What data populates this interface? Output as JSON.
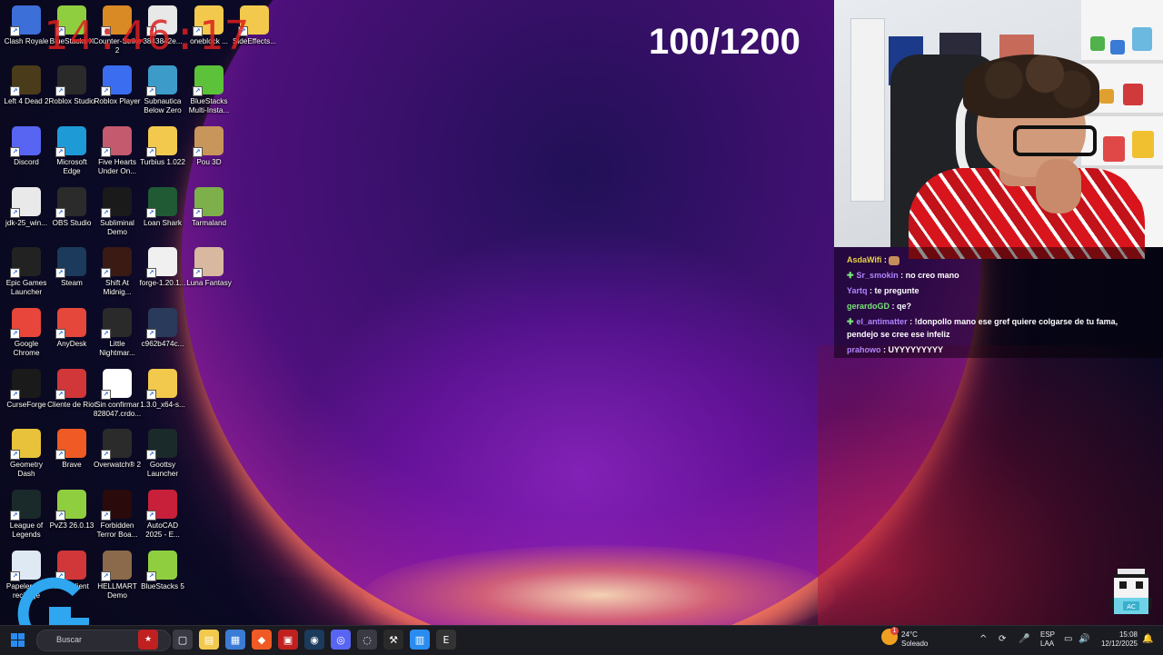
{
  "overlay": {
    "clock": "14:46:17",
    "counter": "100/1200"
  },
  "desktop": {
    "icons": [
      {
        "label": "Clash Royale",
        "icon": "clash-royale-icon",
        "color": "#3d6fd8"
      },
      {
        "label": "BlueStacks X",
        "icon": "bluestacks-icon",
        "color": "#8fcf3f"
      },
      {
        "label": "Counter-Strike 2",
        "icon": "counter-strike-icon",
        "color": "#d98a24"
      },
      {
        "label": "3843842e...",
        "icon": "image-file-icon",
        "color": "#e8e8e8"
      },
      {
        "label": "oneblock ...",
        "icon": "folder-icon",
        "color": "#f2c94c"
      },
      {
        "label": "SideEffects...",
        "icon": "folder-icon",
        "color": "#f2c94c"
      },
      {
        "label": "Left 4 Dead 2",
        "icon": "left4dead-icon",
        "color": "#4a3b1a"
      },
      {
        "label": "Roblox Studio",
        "icon": "roblox-studio-icon",
        "color": "#2a2a2a"
      },
      {
        "label": "Roblox Player",
        "icon": "roblox-player-icon",
        "color": "#3a6df0"
      },
      {
        "label": "Subnautica Below Zero",
        "icon": "subnautica-icon",
        "color": "#3d9bc9"
      },
      {
        "label": "BlueStacks Multi-Insta...",
        "icon": "bluestacks-multi-icon",
        "color": "#5cc23a"
      },
      {
        "label": "Discord",
        "icon": "discord-icon",
        "color": "#5865f2"
      },
      {
        "label": "Microsoft Edge",
        "icon": "edge-icon",
        "color": "#1e9bd7"
      },
      {
        "label": "Five Hearts Under On...",
        "icon": "five-hearts-icon",
        "color": "#c45a6e"
      },
      {
        "label": "Turbius 1.022",
        "icon": "folder-icon",
        "color": "#f2c94c"
      },
      {
        "label": "Pou 3D",
        "icon": "pou-icon",
        "color": "#c8955a"
      },
      {
        "label": "jdk-25_win...",
        "icon": "java-installer-icon",
        "color": "#e9e9e9"
      },
      {
        "label": "OBS Studio",
        "icon": "obs-icon",
        "color": "#2b2b2b"
      },
      {
        "label": "Subliminal Demo",
        "icon": "subliminal-icon",
        "color": "#1a1a1a"
      },
      {
        "label": "Loan Shark",
        "icon": "loan-shark-icon",
        "color": "#1f5a34"
      },
      {
        "label": "Tarmaland",
        "icon": "tarmaland-icon",
        "color": "#7db04a"
      },
      {
        "label": "Epic Games Launcher",
        "icon": "epic-games-icon",
        "color": "#222222"
      },
      {
        "label": "Steam",
        "icon": "steam-icon",
        "color": "#1b3a5c"
      },
      {
        "label": "Shift At Midnig...",
        "icon": "shift-at-midnight-icon",
        "color": "#3a1a12"
      },
      {
        "label": "forge-1.20.1...",
        "icon": "java-file-icon",
        "color": "#f0f0f0"
      },
      {
        "label": "Luna Fantasy",
        "icon": "luna-fantasy-icon",
        "color": "#d9b8a0"
      },
      {
        "label": "Google Chrome",
        "icon": "chrome-icon",
        "color": "#e8463a"
      },
      {
        "label": "AnyDesk",
        "icon": "anydesk-icon",
        "color": "#e5473b"
      },
      {
        "label": "Little Nightmar...",
        "icon": "little-nightmares-icon",
        "color": "#2a2a2a"
      },
      {
        "label": "c962b474c...",
        "icon": "image-file-icon",
        "color": "#2a3a5a"
      },
      {
        "label": "CurseForge",
        "icon": "curseforge-icon",
        "color": "#1a1a1a"
      },
      {
        "label": "Cliente de Riot",
        "icon": "riot-client-icon",
        "color": "#d13639"
      },
      {
        "label": "Sin confirmar 828047.crdo...",
        "icon": "blank-file-icon",
        "color": "#ffffff"
      },
      {
        "label": "1.3.0_x64-s...",
        "icon": "folder-icon",
        "color": "#f2c94c"
      },
      {
        "label": "Geometry Dash",
        "icon": "geometry-dash-icon",
        "color": "#e8c23a"
      },
      {
        "label": "Brave",
        "icon": "brave-icon",
        "color": "#f05a24"
      },
      {
        "label": "Overwatch® 2",
        "icon": "overwatch-icon",
        "color": "#2b2b2b"
      },
      {
        "label": "Goottsy Launcher",
        "icon": "goottsy-icon",
        "color": "#1a2a2a"
      },
      {
        "label": "League of Legends",
        "icon": "league-icon",
        "color": "#1a2a2a"
      },
      {
        "label": "PvZ3 26.0.13",
        "icon": "bluestacks-icon",
        "color": "#8fcf3f"
      },
      {
        "label": "Forbidden Terror Boa...",
        "icon": "forbidden-terror-icon",
        "color": "#2a0a0a"
      },
      {
        "label": "AutoCAD 2025 - E...",
        "icon": "autocad-icon",
        "color": "#c8203a"
      },
      {
        "label": "Papelera de reciclaje",
        "icon": "recycle-bin-icon",
        "color": "#dfe9f3"
      },
      {
        "label": "Riot Client",
        "icon": "riot-client-icon",
        "color": "#d13639"
      },
      {
        "label": "HELLMART Demo",
        "icon": "hellmart-icon",
        "color": "#8a6a4a"
      },
      {
        "label": "BlueStacks 5",
        "icon": "bluestacks-icon",
        "color": "#8fcf3f"
      }
    ]
  },
  "chat": {
    "messages": [
      {
        "user": "AsdaWifi",
        "text": "",
        "color": "#e8d34a",
        "badge": false,
        "emote": true
      },
      {
        "user": "Sr_smokin",
        "text": "no creo mano",
        "color": "#b084ff",
        "badge": true,
        "emote": false
      },
      {
        "user": "Yartq",
        "text": "te pregunte",
        "color": "#b084ff",
        "badge": false,
        "emote": false
      },
      {
        "user": "gerardoGD",
        "text": "qe?",
        "color": "#7be37b",
        "badge": false,
        "emote": false
      },
      {
        "user": "el_antimatter",
        "text": "!donpollo mano ese gref quiere colgarse de tu fama, pendejo se cree ese infeliz",
        "color": "#b084ff",
        "badge": true,
        "emote": false
      },
      {
        "user": "prahowo",
        "text": "UYYYYYYYYY",
        "color": "#b084ff",
        "badge": false,
        "emote": false
      }
    ]
  },
  "taskbar": {
    "search_placeholder": "Buscar",
    "apps": [
      "file-explorer-icon",
      "folder-icon",
      "store-icon",
      "brave-icon",
      "game-icon",
      "steam-icon",
      "discord-icon",
      "obs-icon",
      "curseforge-icon",
      "notepad-icon",
      "epic-games-icon"
    ],
    "weather_temp": "24°C",
    "weather_desc": "Soleado",
    "weather_badge": "1",
    "language": "ESP",
    "keyboard": "LAA",
    "time": "15:08",
    "date": "12/12/2025"
  }
}
